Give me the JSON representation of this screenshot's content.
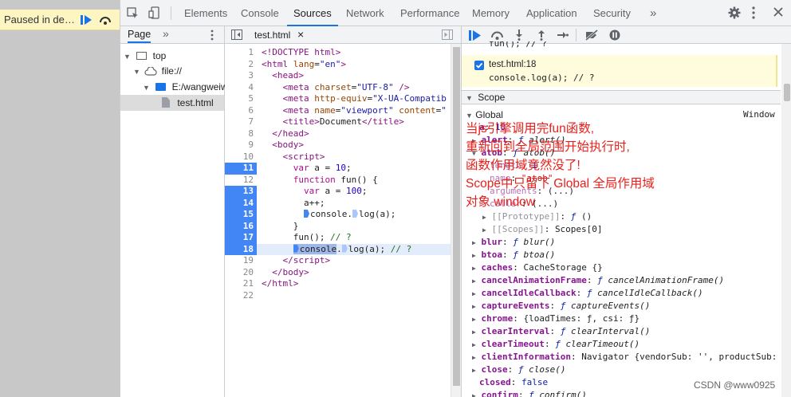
{
  "paused_banner": {
    "text": "Paused in de…"
  },
  "devtools_tabs": [
    "Elements",
    "Console",
    "Sources",
    "Network",
    "Performance",
    "Memory",
    "Application",
    "Security"
  ],
  "overflow_tabs": "»",
  "navigator": {
    "tab": "Page",
    "more": "»",
    "tree": [
      "top",
      "file://",
      "E:/wangweiw",
      "test.html"
    ]
  },
  "editor": {
    "file_tab": "test.html",
    "close": "×",
    "lines": [
      "1",
      "2",
      "3",
      "4",
      "5",
      "6",
      "7",
      "8",
      "9",
      "10",
      "11",
      "12",
      "13",
      "14",
      "15",
      "16",
      "17",
      "18",
      "19",
      "20",
      "21",
      "22"
    ]
  },
  "breakpoint_box": {
    "file": "test.html:18",
    "code": "console.log(a); // ?",
    "above": "fun(); // ?"
  },
  "scope": {
    "header": "Scope",
    "global_label": "Global",
    "global_type": "Window",
    "rows": {
      "a_key": "a",
      "a_val": "10",
      "alert_key": "alert",
      "alert_val": "alert()",
      "atob_key": "atob",
      "atob_val": "atob()",
      "length_key": "length",
      "length_val": "1",
      "name_key": "name",
      "name_val": "\"atob\"",
      "arguments_key": "arguments",
      "arguments_val": "(...)",
      "caller_key": "caller",
      "caller_val": "(...)",
      "proto_key": "[[Prototype]]",
      "proto_val": "()",
      "scopes_key": "[[Scopes]]",
      "scopes_val": "Scopes[0]",
      "blur_key": "blur",
      "blur_val": "blur()",
      "btoa_key": "btoa",
      "btoa_val": "btoa()",
      "caches_key": "caches",
      "caches_val": "CacheStorage {}",
      "caf_key": "cancelAnimationFrame",
      "caf_val": "cancelAnimationFrame()",
      "cic_key": "cancelIdleCallback",
      "cic_val": "cancelIdleCallback()",
      "ce_key": "captureEvents",
      "ce_val": "captureEvents()",
      "chrome_key": "chrome",
      "chrome_val": "{loadTimes: ƒ, csi: ƒ}",
      "ci_key": "clearInterval",
      "ci_val": "clearInterval()",
      "ct_key": "clearTimeout",
      "ct_val": "clearTimeout()",
      "cinfo_key": "clientInformation",
      "cinfo_val": "Navigator {vendorSub: '', productSub:",
      "close_key": "close",
      "close_val": "close()",
      "closed_key": "closed",
      "closed_val": "false",
      "confirm_key": "confirm",
      "confirm_val": "confirm()"
    }
  },
  "annotation": {
    "line1": "当js引擎调用完fun函数,",
    "line2": "重新回到全局范围开始执行时,",
    "line3": "函数作用域竟然没了!",
    "line4": "Scope中只留下 Global 全局作用域",
    "line5": "对象 window"
  },
  "watermark": "CSDN @www0925",
  "colors": {
    "accent": "#1a73e8",
    "breakpoint": "#4285f4",
    "annotation": "#e8211d",
    "paused": "#fdf6c3"
  }
}
